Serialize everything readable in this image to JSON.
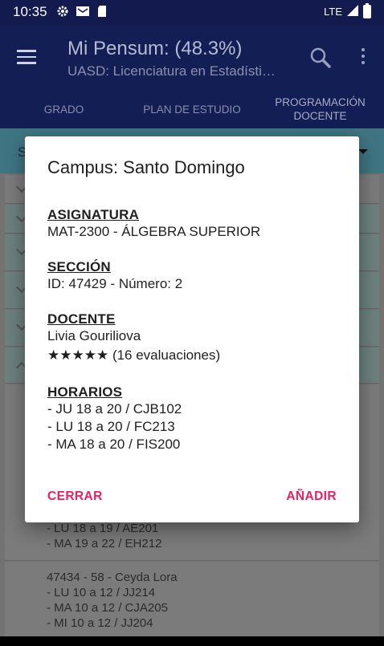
{
  "status_bar": {
    "time": "10:35",
    "network": "LTE"
  },
  "app_bar": {
    "title": "Mi Pensum: (48.3%)",
    "subtitle": "UASD: Licenciatura en Estadísti…",
    "tabs": [
      {
        "label": "GRADO"
      },
      {
        "label": "PLAN DE ESTUDIO"
      },
      {
        "label": "PROGRAMACIÓN DOCENTE"
      }
    ]
  },
  "background": {
    "filter_letter": "S",
    "items": [
      {
        "lines": [
          "- LU 18 a 19 / AE201",
          "- MA 19 a 22 / EH212"
        ]
      },
      {
        "lines": [
          "47434 - 58 - Ceyda Lora",
          "- LU 10 a 12 / JJ214",
          "- MA 10 a 12 / CJA205",
          "- MI 10 a 12 / JJ204"
        ]
      }
    ]
  },
  "dialog": {
    "title": "Campus: Santo Domingo",
    "asignatura_label": "ASIGNATURA",
    "asignatura_value": "MAT-2300 - ÁLGEBRA SUPERIOR",
    "seccion_label": "SECCIÓN",
    "seccion_value": "ID: 47429 - Número: 2",
    "docente_label": "DOCENTE",
    "docente_name": "Livia Gouriliova",
    "rating_stars": "★★★★★",
    "rating_count": "(16 evaluaciones)",
    "horarios_label": "HORARIOS",
    "horarios": [
      "- JU 18 a 20 / CJB102",
      "- LU 18 a 20 / FC213",
      "- MA 18 a 20 / FIS200"
    ],
    "close_label": "CERRAR",
    "add_label": "AÑADIR"
  },
  "colors": {
    "accent": "#e91e63",
    "app_bar": "#131e55",
    "tab_indicator": "#c2185b"
  }
}
